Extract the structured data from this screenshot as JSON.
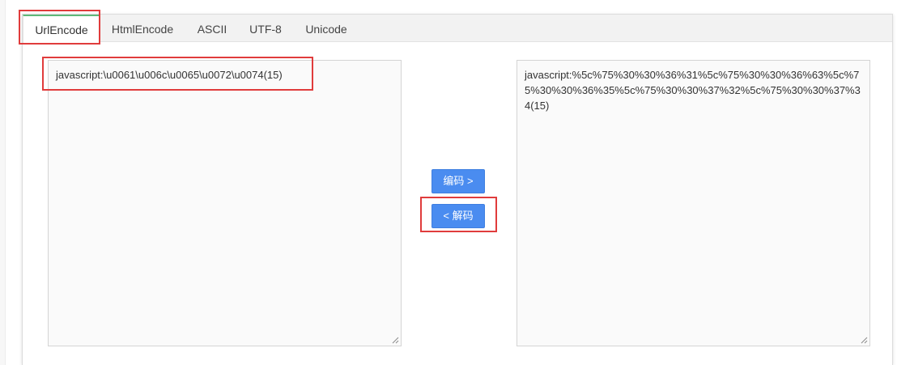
{
  "tabs": [
    {
      "label": "UrlEncode",
      "active": true
    },
    {
      "label": "HtmlEncode",
      "active": false
    },
    {
      "label": "ASCII",
      "active": false
    },
    {
      "label": "UTF-8",
      "active": false
    },
    {
      "label": "Unicode",
      "active": false
    }
  ],
  "input": {
    "value": "javascript:\\u0061\\u006c\\u0065\\u0072\\u0074(15)"
  },
  "output": {
    "value": "javascript:%5c%75%30%30%36%31%5c%75%30%30%36%63%5c%75%30%30%36%35%5c%75%30%30%37%32%5c%75%30%30%37%34(15)"
  },
  "buttons": {
    "encode_label": "编码 >",
    "decode_label": "< 解码"
  },
  "colors": {
    "button": "#4a8cf0",
    "annotation": "#e03c3c",
    "active_tab_accent": "#5fb878"
  }
}
